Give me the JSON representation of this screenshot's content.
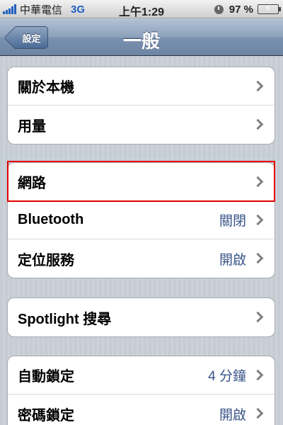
{
  "status_bar": {
    "carrier": "中華電信",
    "network": "3G",
    "time": "上午1:29",
    "battery": "97 %"
  },
  "nav": {
    "back_label": "設定",
    "title": "一般"
  },
  "groups": [
    {
      "rows": [
        {
          "label": "關於本機"
        },
        {
          "label": "用量"
        }
      ]
    },
    {
      "rows": [
        {
          "label": "網路"
        },
        {
          "label": "Bluetooth",
          "value": "關閉"
        },
        {
          "label": "定位服務",
          "value": "開啟"
        }
      ]
    },
    {
      "rows": [
        {
          "label": "Spotlight 搜尋"
        }
      ]
    },
    {
      "rows": [
        {
          "label": "自動鎖定",
          "value": "4 分鐘"
        },
        {
          "label": "密碼鎖定",
          "value": "開啟"
        }
      ]
    }
  ],
  "colors": {
    "value_text": "#385487",
    "highlight_border": "#e60000",
    "battery_fill": "#39c12e"
  }
}
